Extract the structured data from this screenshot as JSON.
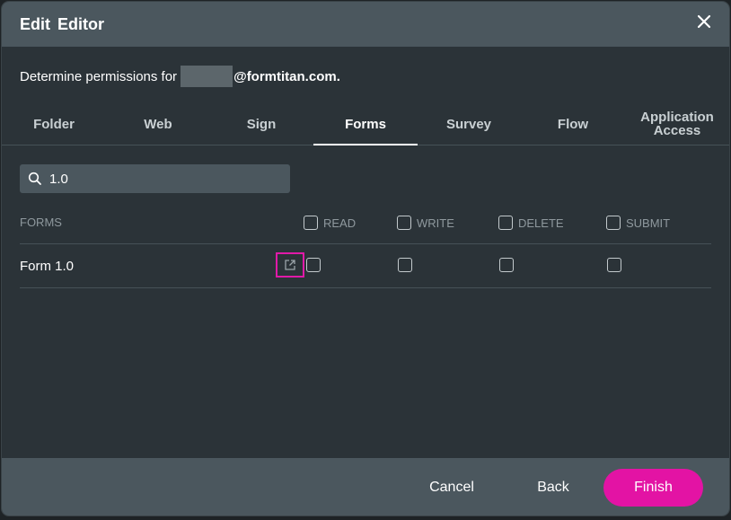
{
  "dialog": {
    "title": "Edit  Editor",
    "subtitle_prefix": "Determine permissions for",
    "subtitle_domain": "@formtitan.com."
  },
  "tabs": [
    {
      "label": "Folder"
    },
    {
      "label": "Web"
    },
    {
      "label": "Sign"
    },
    {
      "label": "Forms",
      "active": true
    },
    {
      "label": "Survey"
    },
    {
      "label": "Flow"
    },
    {
      "label": "Application Access"
    }
  ],
  "search": {
    "value": "1.0"
  },
  "table": {
    "header_label": "FORMS",
    "columns": [
      "READ",
      "WRITE",
      "DELETE",
      "SUBMIT"
    ],
    "rows": [
      {
        "name": "Form 1.0",
        "read": false,
        "write": false,
        "delete": false,
        "submit": false
      }
    ]
  },
  "footer": {
    "cancel": "Cancel",
    "back": "Back",
    "finish": "Finish"
  },
  "colors": {
    "accent": "#e313a4",
    "header_bg": "#4b575e",
    "body_bg": "#2b3338"
  }
}
